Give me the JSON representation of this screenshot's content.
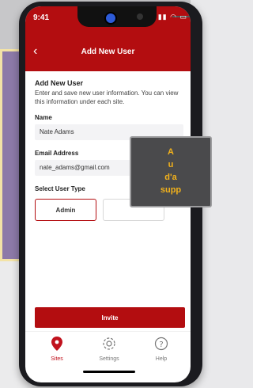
{
  "status": {
    "time": "9:41"
  },
  "header": {
    "title": "Add New User"
  },
  "form": {
    "section_title": "Add New User",
    "section_desc": "Enter and save new user information. You can view this information under each site.",
    "name_label": "Name",
    "name_value": "Nate Adams",
    "email_label": "Email Address",
    "email_value": "nate_adams@gmail.com",
    "type_label": "Select User Type",
    "type_selected": "Admin"
  },
  "overlay": {
    "line1": "A",
    "line2": "u",
    "line3": "d'a",
    "line4": "supp"
  },
  "actions": {
    "invite": "Invite"
  },
  "tabs": [
    {
      "label": "Sites",
      "icon": "pin-icon"
    },
    {
      "label": "Settings",
      "icon": "gear-icon"
    },
    {
      "label": "Help",
      "icon": "help-icon"
    }
  ],
  "colors": {
    "brand_red": "#b30d10",
    "overlay_text": "#f3b21b"
  }
}
